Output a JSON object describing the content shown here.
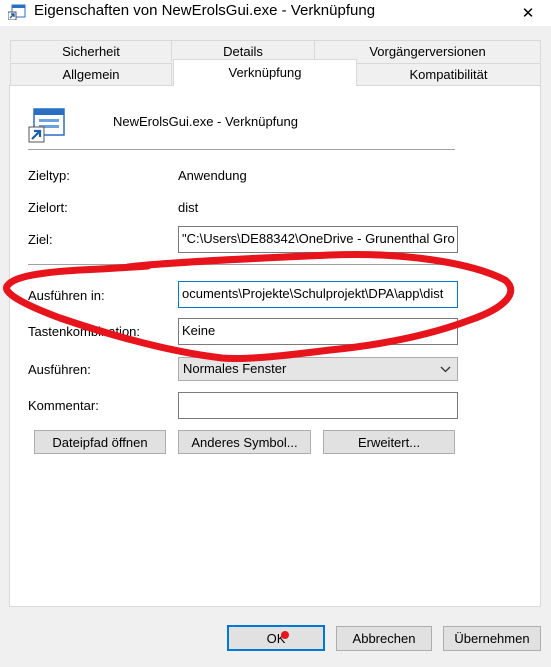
{
  "window": {
    "title": "Eigenschaften von NewErolsGui.exe - Verknüpfung",
    "close_symbol": "✕"
  },
  "tabs": {
    "row1": [
      "Sicherheit",
      "Details",
      "Vorgängerversionen"
    ],
    "row2": [
      "Allgemein",
      "Verknüpfung",
      "Kompatibilität"
    ],
    "active": "Verknüpfung"
  },
  "header": {
    "name": "NewErolsGui.exe - Verknüpfung",
    "icon": "shortcut-app-icon"
  },
  "fields": {
    "zieltyp_label": "Zieltyp:",
    "zieltyp_value": "Anwendung",
    "zielort_label": "Zielort:",
    "zielort_value": "dist",
    "ziel_label": "Ziel:",
    "ziel_value": "\"C:\\Users\\DE88342\\OneDrive - Grunenthal Gro",
    "ausfuehren_in_label": "Ausführen in:",
    "ausfuehren_in_value": "ocuments\\Projekte\\Schulprojekt\\DPA\\app\\dist",
    "tastenkombination_label": "Tastenkombination:",
    "tastenkombination_value": "Keine",
    "ausfuehren_label": "Ausführen:",
    "ausfuehren_value": "Normales Fenster",
    "kommentar_label": "Kommentar:",
    "kommentar_value": ""
  },
  "buttons": {
    "dateipfad": "Dateipfad öffnen",
    "symbol": "Anderes Symbol...",
    "erweitert": "Erweitert...",
    "ok": "OK",
    "abbrechen": "Abbrechen",
    "uebernehmen": "Übernehmen"
  },
  "annotation": {
    "color": "#e8141c",
    "type": "hand-drawn-ellipse"
  },
  "colors": {
    "accent": "#0078d7",
    "panel": "#ffffff",
    "background": "#f0f0f0"
  }
}
